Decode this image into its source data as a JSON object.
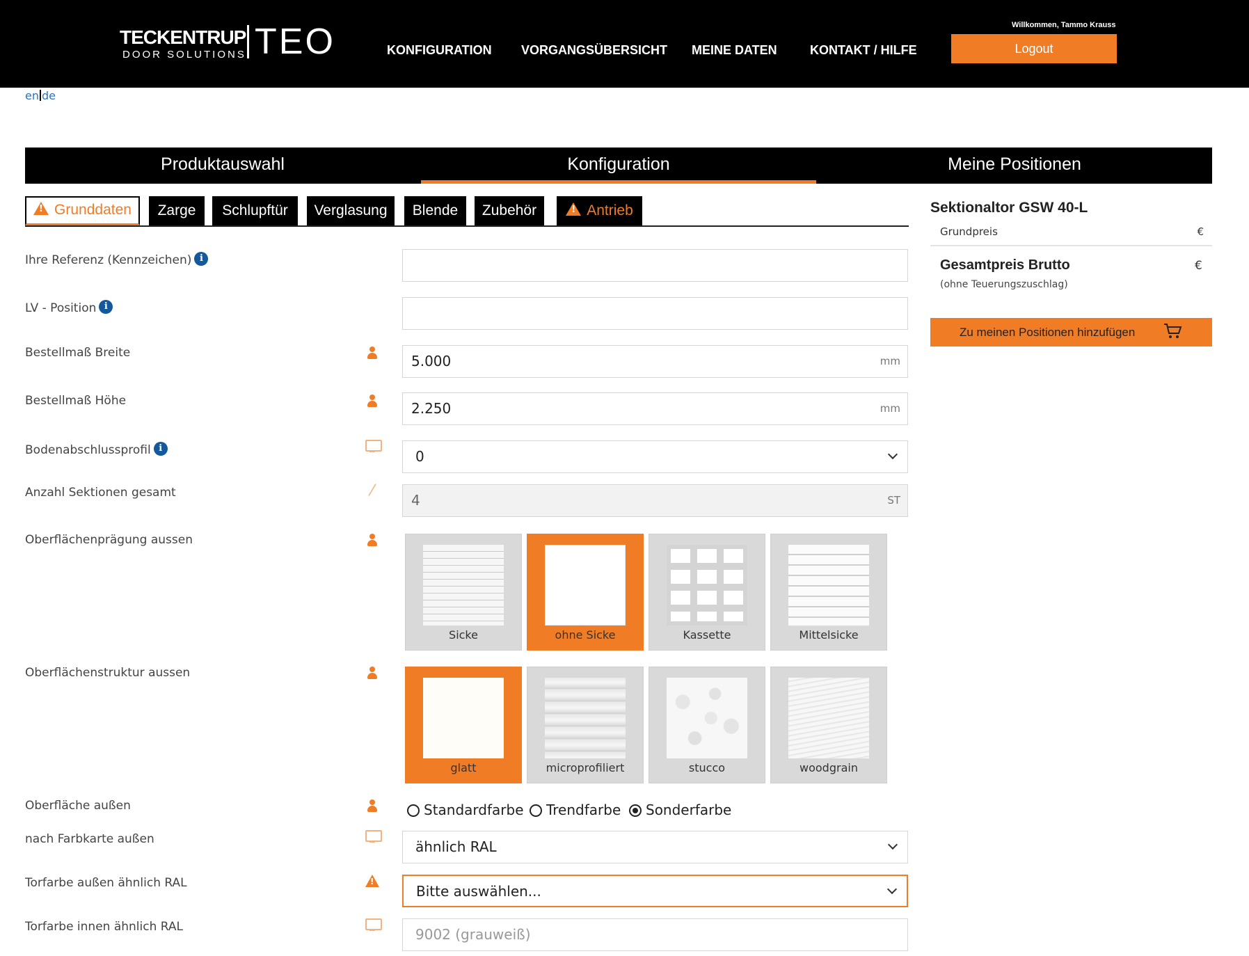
{
  "header": {
    "logo_main": "TECKENTRUP",
    "logo_sub": "DOOR SOLUTIONS",
    "logo_app": "TEO",
    "nav": [
      "KONFIGURATION",
      "VORGANGSÜBERSICHT",
      "MEINE DATEN",
      "KONTAKT / HILFE"
    ],
    "welcome": "Willkommen, Tammo Krauss",
    "logout": "Logout"
  },
  "lang": {
    "en": "en",
    "de": "de"
  },
  "stepper": [
    "Produktauswahl",
    "Konfiguration",
    "Meine Positionen"
  ],
  "tabs": [
    "Grunddaten",
    "Zarge",
    "Schlupftür",
    "Verglasung",
    "Blende",
    "Zubehör",
    "Antrieb"
  ],
  "form": {
    "referenz": {
      "label": "Ihre Referenz (Kennzeichen)",
      "value": ""
    },
    "lv_position": {
      "label": "LV - Position",
      "value": ""
    },
    "breite": {
      "label": "Bestellmaß Breite",
      "value": "5.000",
      "unit": "mm"
    },
    "hoehe": {
      "label": "Bestellmaß Höhe",
      "value": "2.250",
      "unit": "mm"
    },
    "bodenabschluss": {
      "label": "Bodenabschlussprofil",
      "value": "0"
    },
    "sektionen": {
      "label": "Anzahl Sektionen gesamt",
      "value": "4",
      "unit": "ST"
    },
    "praegung": {
      "label": "Oberflächenprägung aussen",
      "options": [
        "Sicke",
        "ohne Sicke",
        "Kassette",
        "Mittelsicke"
      ],
      "selected": "ohne Sicke"
    },
    "struktur": {
      "label": "Oberflächenstruktur aussen",
      "options": [
        "glatt",
        "microprofiliert",
        "stucco",
        "woodgrain"
      ],
      "selected": "glatt"
    },
    "oberflaeche": {
      "label": "Oberfläche außen",
      "options": [
        "Standardfarbe",
        "Trendfarbe",
        "Sonderfarbe"
      ],
      "selected": "Sonderfarbe"
    },
    "farbkarte": {
      "label": "nach Farbkarte außen",
      "value": "ähnlich RAL"
    },
    "torfarbe_aussen": {
      "label": "Torfarbe außen ähnlich RAL",
      "value": "Bitte auswählen..."
    },
    "torfarbe_innen": {
      "label": "Torfarbe innen ähnlich RAL",
      "value": "9002 (grauweiß)"
    }
  },
  "summary": {
    "product": "Sektionaltor GSW 40-L",
    "grundpreis": "Grundpreis",
    "currency": "€",
    "gesamt": "Gesamtpreis Brutto",
    "gesamt_note": "(ohne Teuerungszuschlag)",
    "add_button": "Zu meinen Positionen hinzufügen"
  },
  "colors": {
    "accent": "#f07c26",
    "header_bg": "#000000",
    "info_blue": "#14599b",
    "lang_link": "#2a72c8"
  },
  "icons": [
    "info-icon",
    "person-icon",
    "monitor-icon",
    "magic-wand-icon",
    "warning-icon",
    "cart-icon",
    "chevron-down-icon"
  ]
}
